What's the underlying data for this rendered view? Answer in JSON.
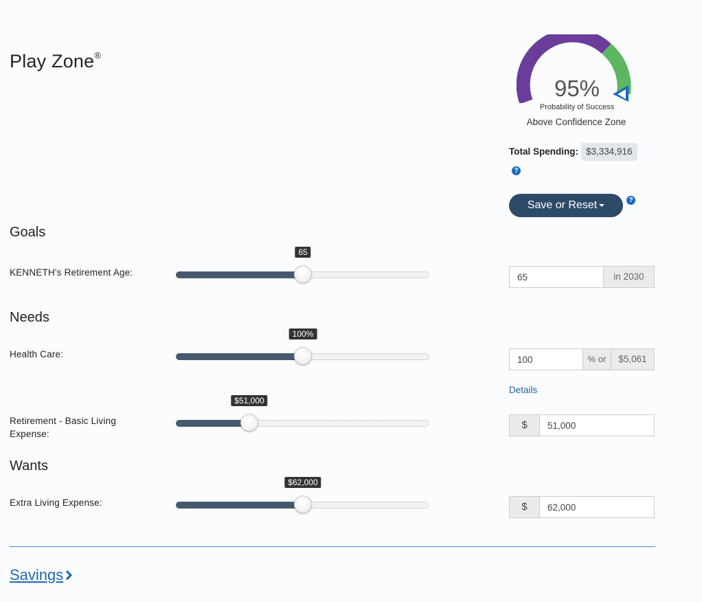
{
  "header": {
    "title": "Play Zone",
    "registered": "®"
  },
  "gauge": {
    "percent_text": "95%",
    "percent_value": 95,
    "subtitle": "Probability of Success",
    "zone": "Above Confidence Zone",
    "colors": {
      "purple": "#6a3d9a",
      "green": "#5db760",
      "marker": "#1a6ac0"
    }
  },
  "spending": {
    "label": "Total Spending:",
    "value": "$3,334,916"
  },
  "help_glyph": "?",
  "save_reset": {
    "label": "Save or Reset"
  },
  "sections": {
    "goals": "Goals",
    "needs": "Needs",
    "wants": "Wants"
  },
  "retirement_age": {
    "label": "KENNETH's Retirement Age:",
    "bubble": "65",
    "slider_fraction": 0.5,
    "input_value": "65",
    "addon": "in 2030"
  },
  "health_care": {
    "label": "Health Care:",
    "bubble": "100%",
    "slider_fraction": 0.5,
    "input_value": "100",
    "addon_pct": "% or",
    "addon_amount": "$5,061",
    "details_link": "Details"
  },
  "basic_living": {
    "label_line1": "Retirement - Basic Living",
    "label_line2": "Expense:",
    "bubble": "$51,000",
    "slider_fraction": 0.29,
    "currency": "$",
    "input_value": "51,000"
  },
  "extra_living": {
    "label": "Extra Living Expense:",
    "bubble": "$62,000",
    "slider_fraction": 0.5,
    "currency": "$",
    "input_value": "62,000"
  },
  "footer": {
    "savings_link": "Savings"
  },
  "colors": {
    "accent": "#2d4a68",
    "link": "#1f66b3",
    "slider_fill": "#46596d"
  }
}
